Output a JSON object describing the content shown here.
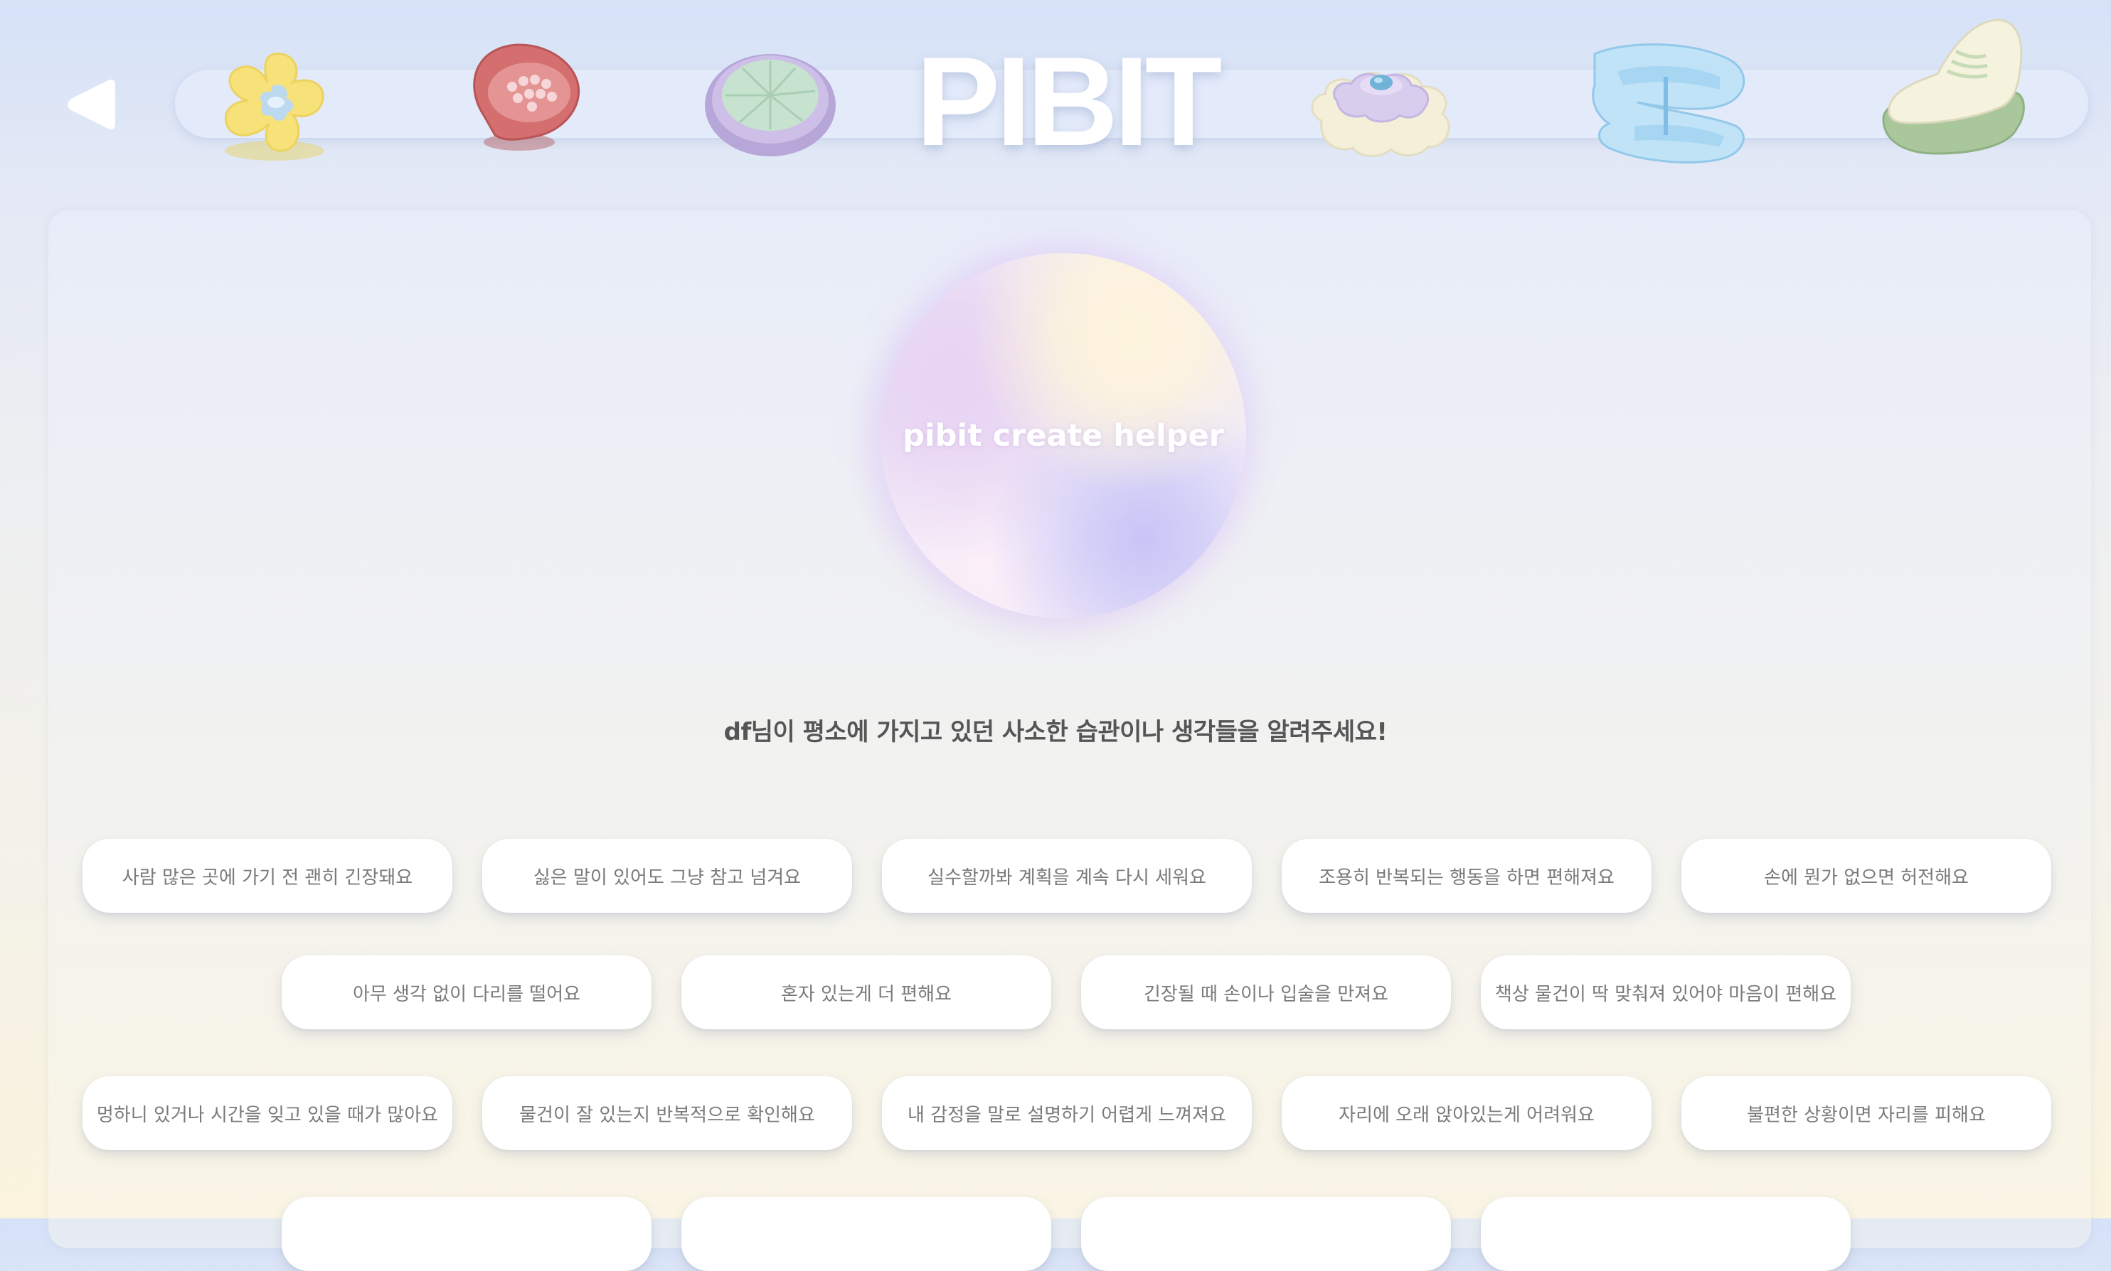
{
  "header": {
    "logo_text": "PIBIT",
    "back_icon": "back-triangle-icon",
    "fidget_icons": [
      "flower-fidget-icon",
      "red-brush-fidget-icon",
      "mint-pleated-fidget-icon",
      "layered-cloud-button-fidget-icon",
      "blue-clip-fidget-icon",
      "sneaker-fidget-icon"
    ]
  },
  "helper": {
    "orb_label": "pibit create helper"
  },
  "prompt": "df님이 평소에 가지고 있던 사소한 습관이나 생각들을 알려주세요!",
  "options": [
    "사람 많은 곳에 가기 전 괜히 긴장돼요",
    "싫은 말이 있어도 그냥 참고 넘겨요",
    "실수할까봐 계획을 계속 다시 세워요",
    "조용히 반복되는 행동을 하면 편해져요",
    "손에 뭔가 없으면 허전해요",
    "아무 생각 없이 다리를 떨어요",
    "혼자 있는게 더 편해요",
    "긴장될 때 손이나 입술을 만져요",
    "책상 물건이 딱 맞춰져 있어야 마음이 편해요",
    "멍하니 있거나 시간을 잊고 있을 때가 많아요",
    "물건이 잘 있는지 반복적으로 확인해요",
    "내 감정을 말로 설명하기 어렵게 느껴져요",
    "자리에 오래 앉아있는게 어려워요",
    "불편한 상황이면 자리를 피해요",
    "",
    "",
    "",
    ""
  ],
  "colors": {
    "chip_text": "#7a7a7a",
    "prompt_text": "#555555",
    "logo": "#ffffff"
  }
}
